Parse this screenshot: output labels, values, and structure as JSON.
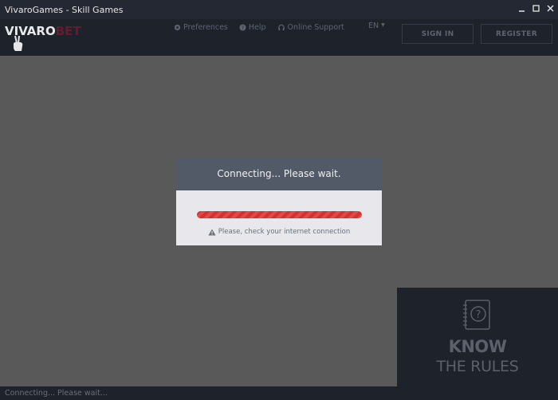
{
  "window": {
    "title": "VivaroGames - Skill Games"
  },
  "header": {
    "logo": {
      "part1": "VIVARO",
      "part2": "BET"
    },
    "nav": {
      "preferences": "Preferences",
      "help": "Help",
      "online_support": "Online Support"
    },
    "language": "EN",
    "sign_in": "SIGN IN",
    "register": "REGISTER"
  },
  "modal": {
    "title": "Connecting... Please wait.",
    "warning": "Please, check your internet connection"
  },
  "rules_panel": {
    "line1": "KNOW",
    "line2": "THE RULES"
  },
  "status_bar": {
    "text": "Connecting... Please wait..."
  },
  "colors": {
    "titlebar": "#232833",
    "header": "#1e222b",
    "backdrop": "#595959",
    "modal_head": "#525a68",
    "modal_body": "#e8e8ec",
    "progress": "#d23232"
  }
}
